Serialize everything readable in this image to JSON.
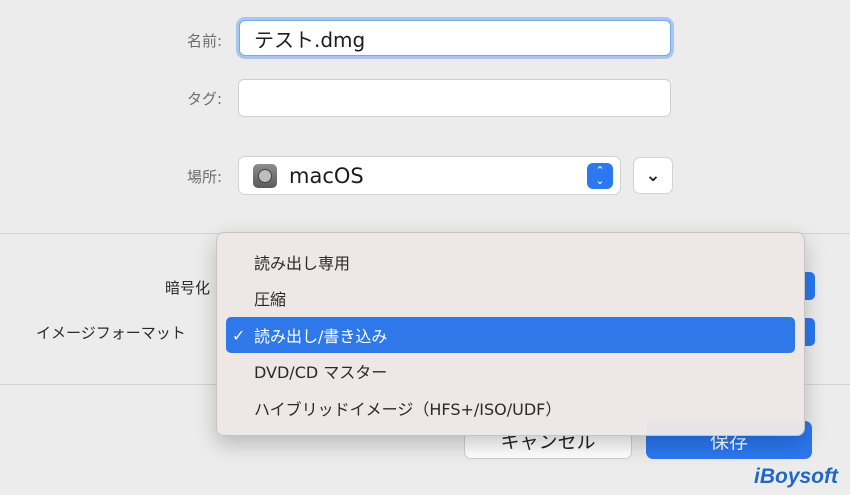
{
  "form": {
    "name_label": "名前:",
    "name_value": "テスト.dmg",
    "tag_label": "タグ:",
    "tag_value": "",
    "location_label": "場所:",
    "location_value": "macOS",
    "stepper_up": "⌃",
    "stepper_down": "⌄",
    "expand_glyph": "⌄",
    "encryption_label": "暗号化",
    "format_label": "イメージフォーマット"
  },
  "format_menu": {
    "items": [
      {
        "label": "読み出し専用",
        "check": ""
      },
      {
        "label": "圧縮",
        "check": ""
      },
      {
        "label": "読み出し/書き込み",
        "check": "✓"
      },
      {
        "label": "DVD/CD マスター",
        "check": ""
      },
      {
        "label": "ハイブリッドイメージ（HFS+/ISO/UDF）",
        "check": ""
      }
    ],
    "selected_index": 2
  },
  "buttons": {
    "cancel": "キャンセル",
    "save": "保存"
  },
  "watermark": "iBoysoft",
  "colors": {
    "accent": "#2b78f0",
    "focus_ring": "#a9c6f1",
    "menu_background": "#ece7e5"
  },
  "icons": {
    "disk": "disk-icon",
    "stepper": "updown-chevron-icon",
    "expand": "chevron-down-icon",
    "check": "checkmark-icon"
  }
}
